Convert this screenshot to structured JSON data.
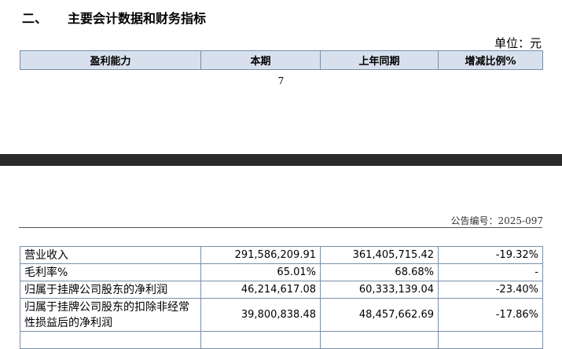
{
  "section": {
    "number": "二、",
    "title": "主要会计数据和财务指标"
  },
  "unit": "单位：元",
  "table_header": {
    "col1": "盈利能力",
    "col2": "本期",
    "col3": "上年同期",
    "col4": "增减比例%"
  },
  "page_number": "7",
  "announcement_no": "公告编号：2025-097",
  "rows": [
    {
      "label": "营业收入",
      "current": "291,586,209.91",
      "prior": "361,405,715.42",
      "change": "-19.32%"
    },
    {
      "label": "毛利率%",
      "current": "65.01%",
      "prior": "68.68%",
      "change": "-"
    },
    {
      "label": "归属于挂牌公司股东的净利润",
      "current": "46,214,617.08",
      "prior": "60,333,139.04",
      "change": "-23.40%"
    },
    {
      "label": "归属于挂牌公司股东的扣除非经常性损益后的净利润",
      "current": "39,800,838.48",
      "prior": "48,457,662.69",
      "change": "-17.86%"
    }
  ]
}
